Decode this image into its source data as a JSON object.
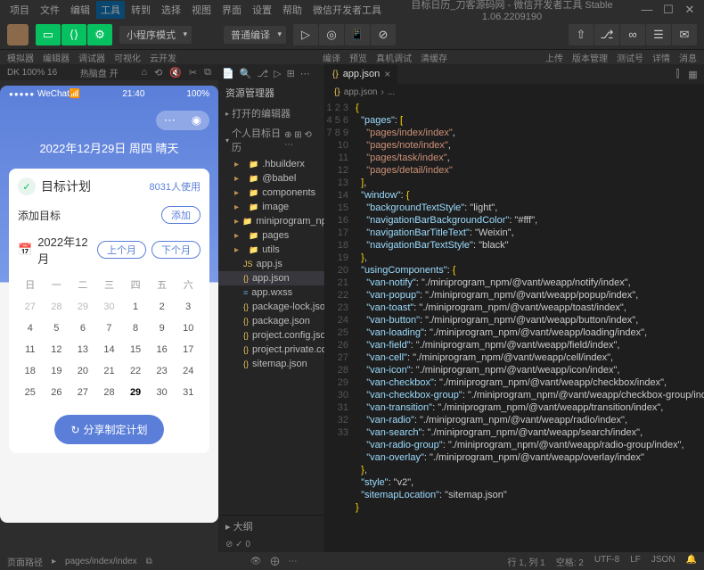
{
  "menu": [
    "项目",
    "文件",
    "编辑",
    "工具",
    "转到",
    "选择",
    "视图",
    "界面",
    "设置",
    "帮助",
    "微信开发者工具"
  ],
  "title": "目标日历_刀客源码网 - 微信开发者工具 Stable 1.06.2209190",
  "toolbar_labels": {
    "sim": "模拟器",
    "editor": "编辑器",
    "debug": "调试器",
    "visual": "可视化",
    "cloud": "云开发"
  },
  "dropdown1": "小程序模式",
  "dropdown2": "普通编译",
  "toolbar_right_labels": {
    "compile": "编译",
    "preview": "预览",
    "realdev": "真机调试",
    "clear": "清缓存",
    "upload": "上传",
    "version": "版本管理",
    "test": "测试号",
    "detail": "详情",
    "msg": "消息"
  },
  "sim_bar": {
    "zoom": "DK 100% 16",
    "theme": "热脑盘 开"
  },
  "phone": {
    "network": "WeChat",
    "signal": "●●●●●",
    "time": "21:40",
    "battery": "100%",
    "date": "2022年12月29日 周四 晴天",
    "card_title": "目标计划",
    "card_count": "8031人使用",
    "add_label": "添加目标",
    "add_btn": "添加",
    "cal_month": "2022年12月",
    "prev": "上个月",
    "next": "下个月",
    "dow": [
      "日",
      "一",
      "二",
      "三",
      "四",
      "五",
      "六"
    ],
    "share": "分享制定计划"
  },
  "calendar_days": [
    {
      "n": 27
    },
    {
      "n": 28
    },
    {
      "n": 29
    },
    {
      "n": 30
    },
    {
      "n": 1,
      "c": 1
    },
    {
      "n": 2,
      "c": 1
    },
    {
      "n": 3,
      "c": 1
    },
    {
      "n": 4,
      "c": 1
    },
    {
      "n": 5,
      "c": 1
    },
    {
      "n": 6,
      "c": 1
    },
    {
      "n": 7,
      "c": 1
    },
    {
      "n": 8,
      "c": 1
    },
    {
      "n": 9,
      "c": 1
    },
    {
      "n": 10,
      "c": 1
    },
    {
      "n": 11,
      "c": 1
    },
    {
      "n": 12,
      "c": 1
    },
    {
      "n": 13,
      "c": 1
    },
    {
      "n": 14,
      "c": 1
    },
    {
      "n": 15,
      "c": 1
    },
    {
      "n": 16,
      "c": 1
    },
    {
      "n": 17,
      "c": 1
    },
    {
      "n": 18,
      "c": 1
    },
    {
      "n": 19,
      "c": 1
    },
    {
      "n": 20,
      "c": 1
    },
    {
      "n": 21,
      "c": 1
    },
    {
      "n": 22,
      "c": 1
    },
    {
      "n": 23,
      "c": 1
    },
    {
      "n": 24,
      "c": 1
    },
    {
      "n": 25,
      "c": 1
    },
    {
      "n": 26,
      "c": 1
    },
    {
      "n": 27,
      "c": 1
    },
    {
      "n": 28,
      "c": 1
    },
    {
      "n": 29,
      "t": 1
    },
    {
      "n": 30,
      "c": 1
    },
    {
      "n": 31,
      "c": 1
    }
  ],
  "explorer": {
    "title": "资源管理器",
    "sections": {
      "open": "打开的编辑器",
      "project": "个人目标日历"
    },
    "tree": [
      {
        "label": ".hbuilderx",
        "type": "folder"
      },
      {
        "label": "@babel",
        "type": "folder"
      },
      {
        "label": "components",
        "type": "folder"
      },
      {
        "label": "image",
        "type": "folder"
      },
      {
        "label": "miniprogram_npm",
        "type": "folder"
      },
      {
        "label": "pages",
        "type": "folder"
      },
      {
        "label": "utils",
        "type": "folder"
      },
      {
        "label": "app.js",
        "type": "js"
      },
      {
        "label": "app.json",
        "type": "json",
        "selected": true
      },
      {
        "label": "app.wxss",
        "type": "wxss"
      },
      {
        "label": "package-lock.json",
        "type": "json"
      },
      {
        "label": "package.json",
        "type": "json"
      },
      {
        "label": "project.config.json",
        "type": "json"
      },
      {
        "label": "project.private.config.js...",
        "type": "json"
      },
      {
        "label": "sitemap.json",
        "type": "json"
      }
    ],
    "outline": "大纲"
  },
  "editor": {
    "tab": "app.json",
    "breadcrumb": [
      "app.json",
      "..."
    ],
    "status_left": "0"
  },
  "code_lines": [
    "{",
    "  \"pages\": [",
    "    \"pages/index/index\",",
    "    \"pages/note/index\",",
    "    \"pages/task/index\",",
    "    \"pages/detail/index\"",
    "  ],",
    "  \"window\": {",
    "    \"backgroundTextStyle\": \"light\",",
    "    \"navigationBarBackgroundColor\": \"#fff\",",
    "    \"navigationBarTitleText\": \"Weixin\",",
    "    \"navigationBarTextStyle\": \"black\"",
    "  },",
    "  \"usingComponents\": {",
    "    \"van-notify\": \"./miniprogram_npm/@vant/weapp/notify/index\",",
    "    \"van-popup\": \"./miniprogram_npm/@vant/weapp/popup/index\",",
    "    \"van-toast\": \"./miniprogram_npm/@vant/weapp/toast/index\",",
    "    \"van-button\": \"./miniprogram_npm/@vant/weapp/button/index\",",
    "    \"van-loading\": \"./miniprogram_npm/@vant/weapp/loading/index\",",
    "    \"van-field\": \"./miniprogram_npm/@vant/weapp/field/index\",",
    "    \"van-cell\": \"./miniprogram_npm/@vant/weapp/cell/index\",",
    "    \"van-icon\": \"./miniprogram_npm/@vant/weapp/icon/index\",",
    "    \"van-checkbox\": \"./miniprogram_npm/@vant/weapp/checkbox/index\",",
    "    \"van-checkbox-group\": \"./miniprogram_npm/@vant/weapp/checkbox-group/index\",",
    "    \"van-transition\": \"./miniprogram_npm/@vant/weapp/transition/index\",",
    "    \"van-radio\": \"./miniprogram_npm/@vant/weapp/radio/index\",",
    "    \"van-search\": \"./miniprogram_npm/@vant/weapp/search/index\",",
    "    \"van-radio-group\": \"./miniprogram_npm/@vant/weapp/radio-group/index\",",
    "    \"van-overlay\": \"./miniprogram_npm/@vant/weapp/overlay/index\"",
    "  },",
    "  \"style\": \"v2\",",
    "  \"sitemapLocation\": \"sitemap.json\"",
    "}"
  ],
  "statusbar": {
    "path": "页面路径",
    "page": "pages/index/index",
    "pos": "行 1, 列 1",
    "spaces": "空格: 2",
    "enc": "UTF-8",
    "eol": "LF",
    "lang": "JSON"
  }
}
